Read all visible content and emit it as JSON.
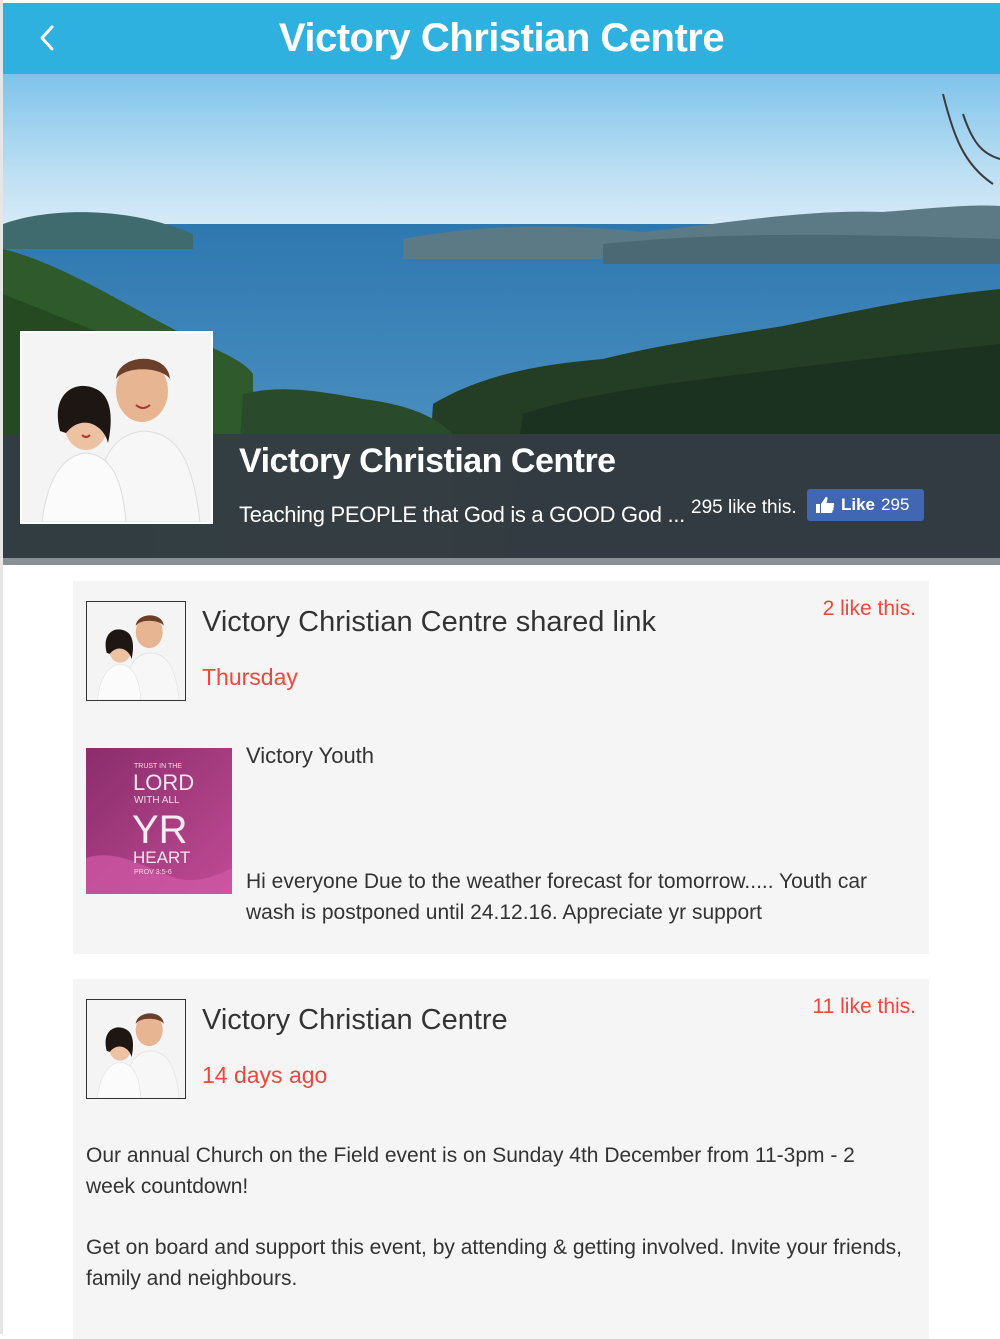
{
  "navbar": {
    "title": "Victory Christian Centre",
    "back_icon": "chevron-left-icon",
    "color": "#2eb1df"
  },
  "cover": {
    "page_name": "Victory Christian Centre",
    "tagline": "Teaching PEOPLE that God is a GOOD God ...",
    "likes_text": "295 like this.",
    "like_button": {
      "label": "Like",
      "count": "295",
      "icon": "thumbs-up-icon",
      "color": "#4267b2"
    }
  },
  "posts": [
    {
      "title": "Victory Christian Centre shared link",
      "date": "Thursday",
      "likes": "2 like this.",
      "link": {
        "thumb_lines": [
          "TRUST IN THE",
          "LORD",
          "WITH ALL",
          "YR",
          "HEART",
          "PROV 3:5-6"
        ],
        "title": "Victory Youth",
        "description": "Hi everyone Due to the weather forecast for tomorrow..... Youth car wash is postponed until 24.12.16. Appreciate yr support"
      }
    },
    {
      "title": "Victory Christian Centre",
      "date": "14 days ago",
      "likes": "11 like this.",
      "body": [
        "Our annual Church on the Field event is on Sunday 4th December from 11-3pm - 2 week countdown!",
        "Get on board and support this event, by attending & getting involved. Invite your friends, family and neighbours."
      ]
    }
  ],
  "colors": {
    "accent_red": "#f0473d",
    "cover_bar": "#343c44"
  }
}
